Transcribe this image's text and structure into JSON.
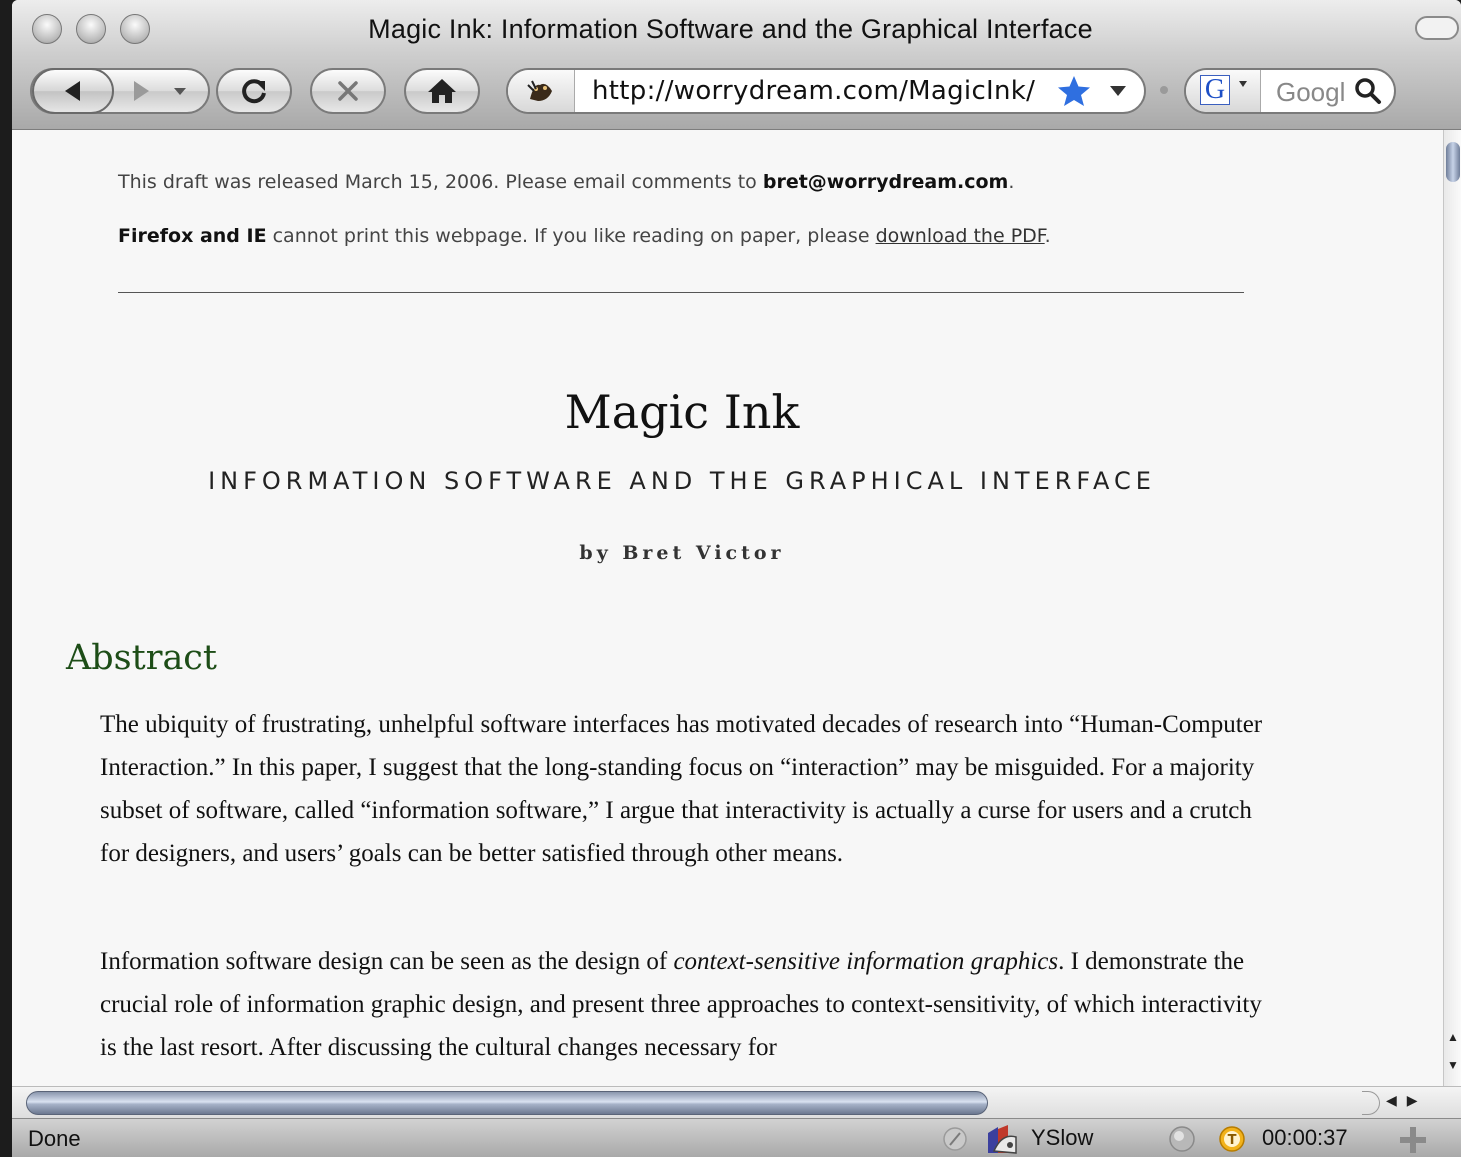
{
  "window": {
    "title": "Magic Ink: Information Software and the Graphical Interface"
  },
  "toolbar": {
    "url": "http://worrydream.com/MagicInk/",
    "search_placeholder": "Googl",
    "search_engine_letter": "G"
  },
  "page": {
    "notice_prefix": "This draft was released March 15, 2006. Please email comments to ",
    "notice_email": "bret@worrydream.com",
    "notice_suffix": ".",
    "print_bold": "Firefox and IE",
    "print_text": " cannot print this webpage. If you like reading on paper, please ",
    "print_link": "download the PDF",
    "print_suffix": ".",
    "title": "Magic Ink",
    "subtitle": "INFORMATION SOFTWARE AND THE GRAPHICAL INTERFACE",
    "byline": "by Bret Victor",
    "abstract_heading": "Abstract",
    "paragraph1": "The ubiquity of frustrating, unhelpful software interfaces has motivated decades of research into “Human-Computer Interaction.” In this paper, I suggest that the long-standing focus on “interaction” may be misguided. For a majority subset of software, called “information software,” I argue that interactivity is actually a curse for users and a crutch for designers, and users’ goals can be better satisfied through other means.",
    "paragraph2_a": "Information software design can be seen as the design of ",
    "paragraph2_em": "context-sensitive information graphics",
    "paragraph2_b": ". I demonstrate the crucial role of information graphic design, and present three approaches to context-sensitivity, of which interactivity is the last resort. After discussing the cultural changes necessary for"
  },
  "statusbar": {
    "text": "Done",
    "yslow_label": "YSlow",
    "timer": "00:00:37"
  },
  "colors": {
    "heading_green": "#1d4d17",
    "link_star": "#2f6fe0"
  }
}
